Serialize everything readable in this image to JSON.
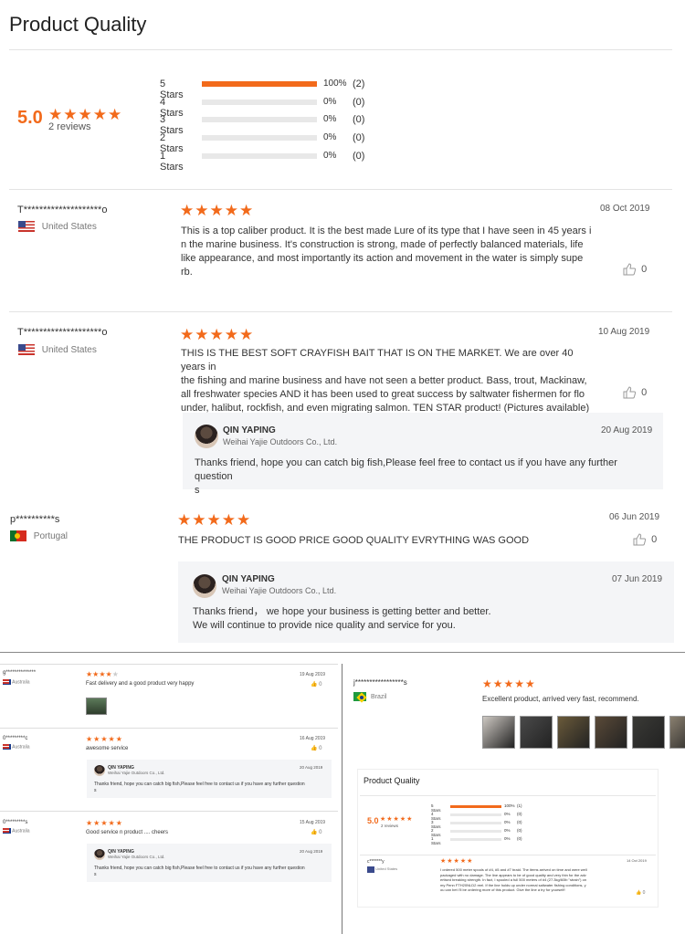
{
  "title": "Product Quality",
  "summary": {
    "score": "5.0",
    "reviews_label": "2 reviews",
    "rows": [
      {
        "label": "5 Stars",
        "percent": "100%",
        "count": "(2)",
        "fill": 1.0
      },
      {
        "label": "4 Stars",
        "percent": "0%",
        "count": "(0)",
        "fill": 0
      },
      {
        "label": "3 Stars",
        "percent": "0%",
        "count": "(0)",
        "fill": 0
      },
      {
        "label": "2 Stars",
        "percent": "0%",
        "count": "(0)",
        "fill": 0
      },
      {
        "label": "1 Stars",
        "percent": "0%",
        "count": "(0)",
        "fill": 0
      }
    ]
  },
  "reviews": [
    {
      "name": "T********************o",
      "country": "United States",
      "date": "08 Oct 2019",
      "text_lines": [
        "This is a top caliber product. It is the best made Lure of its type that I have seen in 45 years i",
        "n the marine business. It's construction is strong, made of perfectly balanced materials, life",
        " like appearance, and most importantly its action and movement in the water is simply supe",
        "rb."
      ],
      "likes": "0"
    },
    {
      "name": "T********************o",
      "country": "United States",
      "date": "10 Aug 2019",
      "text_lines": [
        "THIS IS THE BEST SOFT CRAYFISH BAIT THAT IS ON THE MARKET. We are over 40 years in",
        " the fishing and marine business and have not seen a better product. Bass, trout, Mackinaw,",
        " all freshwater species AND it has been used to great success by saltwater fishermen for flo",
        "under, halibut, rockfish, and even migrating salmon. TEN STAR product! (Pictures available)"
      ],
      "likes": "0",
      "reply": {
        "name": "QIN YAPING",
        "company": "Weihai Yajie Outdoors Co., Ltd.",
        "date": "20 Aug 2019",
        "text_lines": [
          "Thanks friend, hope you can catch big fish,Please feel free to contact us if you have any further question",
          "s"
        ]
      }
    },
    {
      "name": "p**********s",
      "country": "Portugal",
      "date": "06 Jun 2019",
      "text": "THE PRODUCT IS GOOD PRICE GOOD QUALITY EVRYTHING WAS GOOD",
      "likes": "0",
      "reply": {
        "name": "QIN YAPING",
        "company": "Weihai Yajie Outdoors Co., Ltd.",
        "date": "07 Jun 2019",
        "text_lines": [
          "Thanks friend， we hope your business is getting better and better.",
          "We will continue to provide nice quality and service for you."
        ]
      }
    }
  ],
  "mini_left": [
    {
      "name": "g**************",
      "country": "Australia",
      "date": "19 Aug 2019",
      "text": "Fast delivery and a good product very happy",
      "likes": "0",
      "stars": 4
    },
    {
      "name": "0*********c",
      "country": "Australia",
      "date": "16 Aug 2019",
      "text": "awesome service",
      "likes": "0",
      "stars": 5,
      "reply": {
        "name": "QIN YAPING",
        "company": "Weihai Yajie Outdoors Co., Ltd.",
        "date": "20 Aug 2019",
        "text": "Thanks friend, hope you can catch big fish,Please feel free to contact us if you have any further question",
        "text2": "s"
      }
    },
    {
      "name": "0*********s",
      "country": "Australia",
      "date": "15 Aug 2019",
      "text": "Good service n product .... cheers",
      "likes": "0",
      "stars": 5,
      "reply": {
        "name": "QIN YAPING",
        "company": "Weihai Yajie Outdoors Co., Ltd.",
        "date": "20 Aug 2019",
        "text": "Thanks friend, hope you can catch big fish,Please feel free to contact us if you have any further question",
        "text2": "s"
      }
    }
  ],
  "mini_right": {
    "name": "j*****************s",
    "country": "Brazil",
    "text": "Excellent product, arrived very fast, recommend."
  },
  "nested": {
    "title": "Product Quality",
    "score": "5.0",
    "reviews_label": "2 reviews",
    "rows": [
      {
        "label": "5 Stars",
        "percent": "100%",
        "count": "(1)"
      },
      {
        "label": "4 Stars",
        "percent": "0%",
        "count": "(0)"
      },
      {
        "label": "3 Stars",
        "percent": "0%",
        "count": "(0)"
      },
      {
        "label": "2 Stars",
        "percent": "0%",
        "count": "(0)"
      },
      {
        "label": "1 Stars",
        "percent": "0%",
        "count": "(0)"
      }
    ],
    "review": {
      "name": "c*******y",
      "country": "United States",
      "date": "14 Oct 2019",
      "lines": [
        "I ordered 500 meter spools of #4, #5 and #7 braid. The items arrived on time and were well",
        "packaged with no damage. The line appears to be of good quality and very thin for the adv",
        "ertised breaking strength. In fact, I spooled a full 500 meters of #4 (27.3kg/60lb \"strain\") on",
        "my Penn FTH20NLD2 reel. If the line holds up under normal saltwater fishing conditions, y",
        "ou can bet I'll be ordering more of this product. Give the line a try for yourself!"
      ],
      "likes": "0"
    }
  },
  "stars": {
    "five": "★★★★★",
    "four_filled": "★★★★",
    "one_empty": "★"
  },
  "icons": {
    "thumb": "thumbs-up-icon"
  },
  "colors": {
    "accent": "#f26a1b"
  }
}
